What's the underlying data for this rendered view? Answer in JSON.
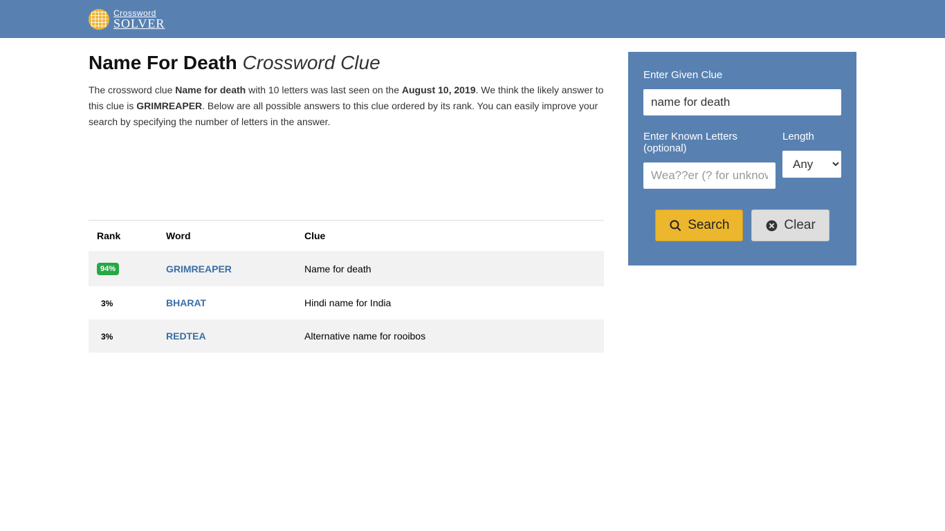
{
  "brand": {
    "top": "Crossword",
    "bottom": "SOLVER"
  },
  "title": {
    "main": "Name For Death",
    "sub": "Crossword Clue"
  },
  "intro": {
    "t1": "The crossword clue ",
    "b1": "Name for death",
    "t2": " with 10 letters was last seen on the ",
    "b2": "August 10, 2019",
    "t3": ". We think the likely answer to this clue is ",
    "b3": "GRIMREAPER",
    "t4": ". Below are all possible answers to this clue ordered by its rank. You can easily improve your search by specifying the number of letters in the answer."
  },
  "table": {
    "headers": {
      "rank": "Rank",
      "word": "Word",
      "clue": "Clue"
    },
    "rows": [
      {
        "rank": "94%",
        "badge": true,
        "word": "GRIMREAPER",
        "clue": "Name for death"
      },
      {
        "rank": "3%",
        "badge": false,
        "word": "BHARAT",
        "clue": "Hindi name for India"
      },
      {
        "rank": "3%",
        "badge": false,
        "word": "REDTEA",
        "clue": "Alternative name for rooibos"
      }
    ]
  },
  "sidebar": {
    "clue_label": "Enter Given Clue",
    "clue_value": "name for death",
    "letters_label": "Enter Known Letters (optional)",
    "letters_placeholder": "Wea??er (? for unknown)",
    "length_label": "Length",
    "length_value": "Any",
    "search_label": "Search",
    "clear_label": "Clear"
  }
}
